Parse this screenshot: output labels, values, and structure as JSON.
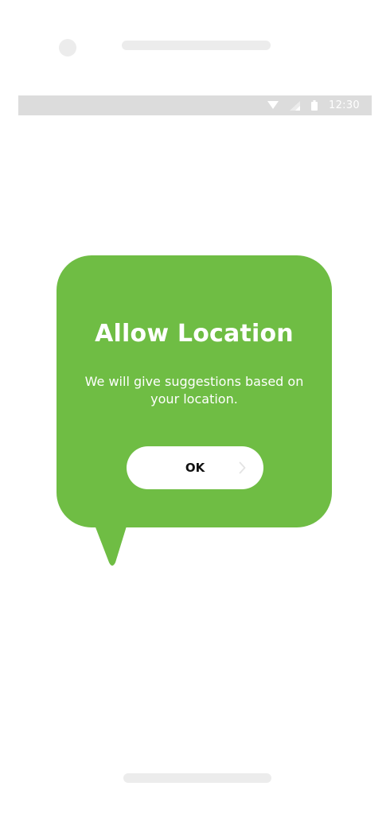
{
  "status_bar": {
    "time": "12:30",
    "icons": [
      "wifi-icon",
      "signal-icon",
      "battery-icon"
    ]
  },
  "dialog": {
    "title": "Allow Location",
    "message": "We will give suggestions based on your location.",
    "ok_label": "OK",
    "ok_icon": "chevron-right-icon",
    "bubble_color": "#6fbd44",
    "button_color": "#ffffff"
  }
}
